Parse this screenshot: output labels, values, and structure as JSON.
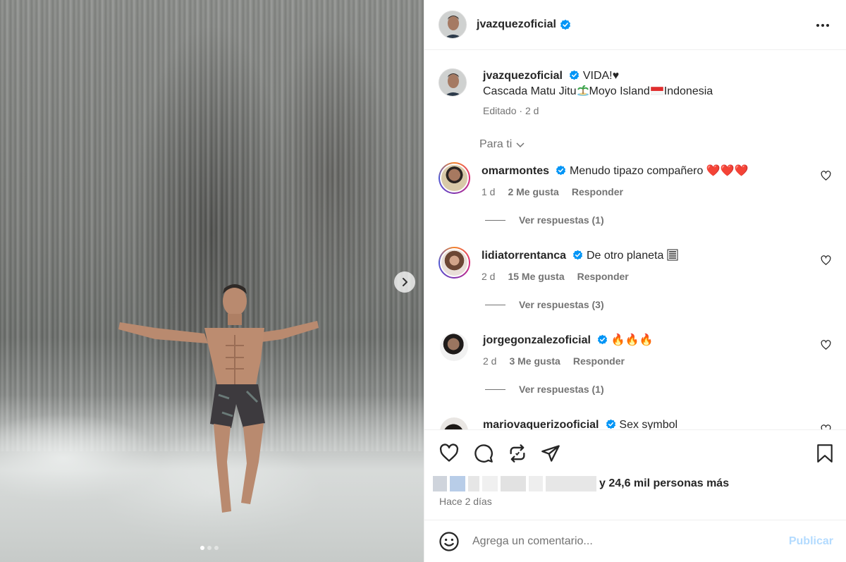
{
  "post": {
    "owner": "jvazquezoficial",
    "caption_text": "VIDA!♥",
    "location_line": {
      "part1": "Cascada Matu Jitu",
      "part2": "Moyo Island",
      "part3": "Indonesia"
    },
    "edited_label": "Editado",
    "edited_ago": "2 d"
  },
  "filter_label": "Para ti",
  "comments": [
    {
      "user": "omarmontes",
      "text": "Menudo tipazo compañero",
      "emoji": "❤️❤️❤️",
      "age": "1 d",
      "likes": "2 Me gusta",
      "reply": "Responder",
      "replies": "Ver respuestas (1)"
    },
    {
      "user": "lidiatorrentanca",
      "text": "De otro planeta",
      "emoji": "",
      "age": "2 d",
      "likes": "15 Me gusta",
      "reply": "Responder",
      "replies": "Ver respuestas (3)"
    },
    {
      "user": "jorgegonzalezoficial",
      "text": "",
      "emoji": "🔥🔥🔥",
      "age": "2 d",
      "likes": "3 Me gusta",
      "reply": "Responder",
      "replies": "Ver respuestas (1)"
    },
    {
      "user": "mariovaquerizooficial",
      "text": "Sex symbol",
      "emoji": "",
      "age": "",
      "likes": "",
      "reply": "",
      "replies": ""
    }
  ],
  "likes_summary": "y 24,6 mil personas más",
  "posted_ago": "Hace 2 días",
  "comment_box": {
    "placeholder": "Agrega un comentario...",
    "publish_label": "Publicar"
  },
  "carousel": {
    "count": 3,
    "active_index": 0
  },
  "colors": {
    "verified": "#0095f6",
    "text": "#262626",
    "muted": "#737373",
    "publish_disabled": "#b3dbff",
    "heart_red": "#ed4956"
  }
}
